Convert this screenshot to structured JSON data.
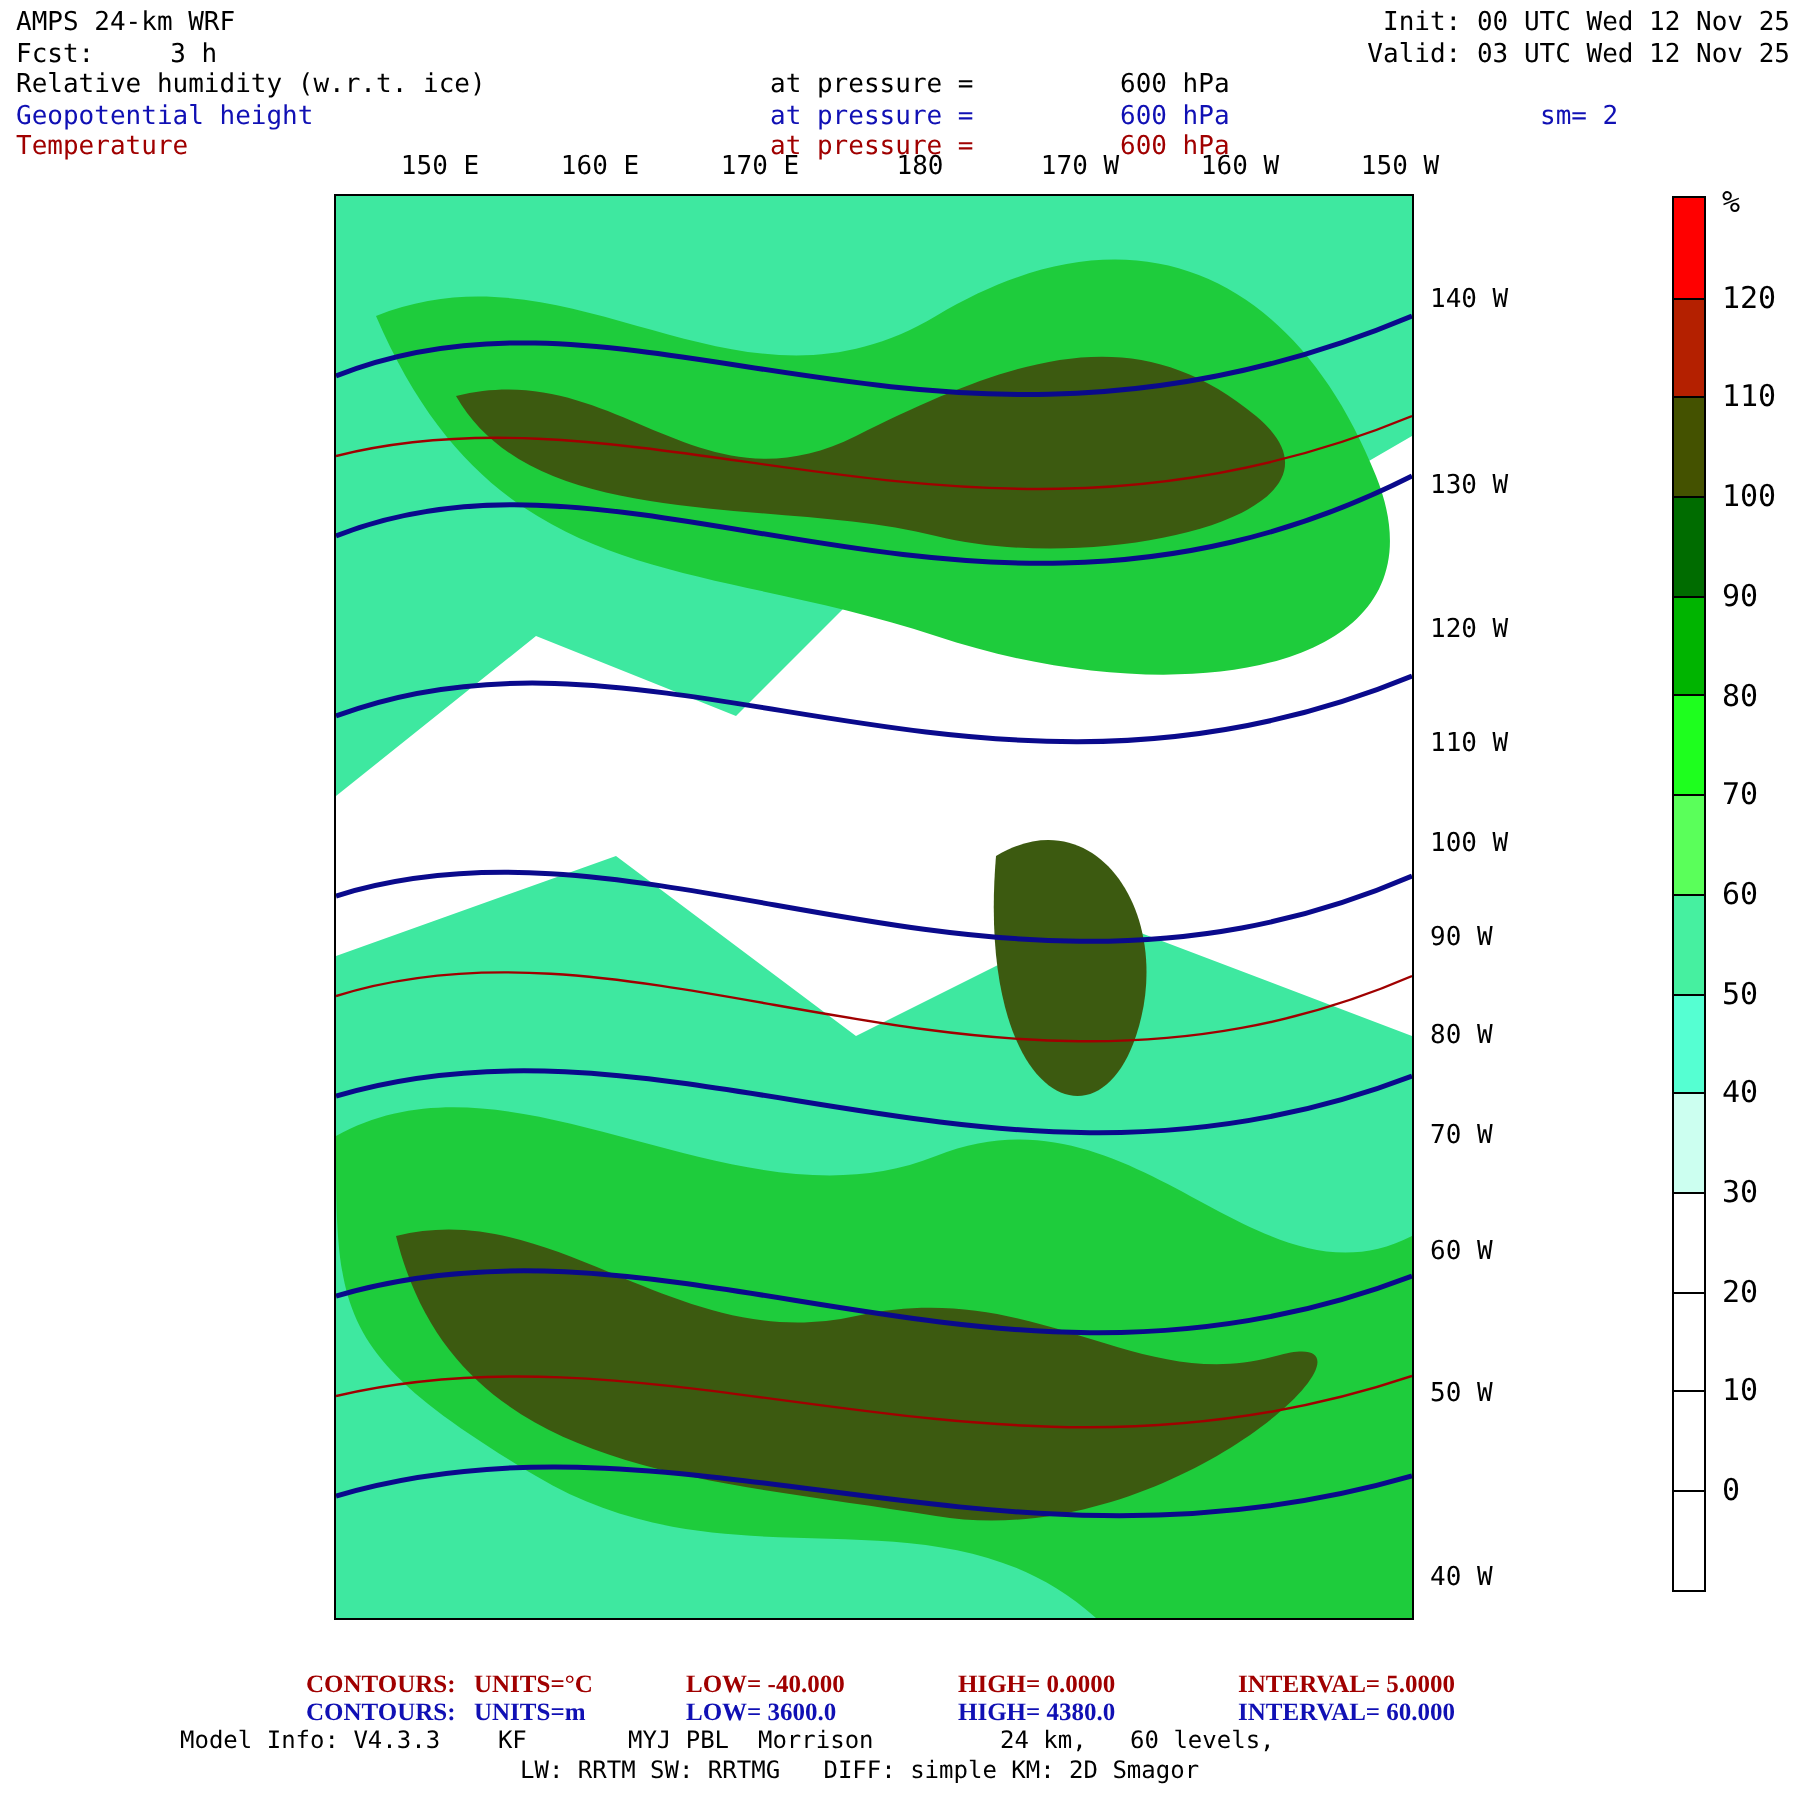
{
  "header": {
    "title": "AMPS 24-km WRF",
    "forecast_label": "Fcst:",
    "forecast": "3 h",
    "init": "Init: 00 UTC Wed 12 Nov 25",
    "valid": "Valid: 03 UTC Wed 12 Nov 25",
    "smoothing": "sm= 2"
  },
  "fields": [
    {
      "name": "Relative humidity (w.r.t. ice)",
      "level_label": "at pressure =",
      "level": "600 hPa",
      "color": "#000000"
    },
    {
      "name": "Geopotential height",
      "level_label": "at pressure =",
      "level": "600 hPa",
      "color": "#1010b4"
    },
    {
      "name": "Temperature",
      "level_label": "at pressure =",
      "level": "600 hPa",
      "color": "#a00000"
    }
  ],
  "map": {
    "top_labels": [
      "150 E",
      "160 E",
      "170 E",
      "180",
      "170 W",
      "160 W",
      "150 W"
    ],
    "right_labels": [
      "140 W",
      "130 W",
      "120 W",
      "110 W",
      "100 W",
      "90 W",
      "80 W",
      "70 W",
      "60 W",
      "50 W",
      "40 W"
    ]
  },
  "colorbar": {
    "unit": "%",
    "bins": [
      {
        "color": "#ff0000",
        "label": "120"
      },
      {
        "color": "#b42000",
        "label": "110"
      },
      {
        "color": "#445200",
        "label": "100"
      },
      {
        "color": "#006c00",
        "label": "90"
      },
      {
        "color": "#00b400",
        "label": "80"
      },
      {
        "color": "#1eff1e",
        "label": "70"
      },
      {
        "color": "#5aff5a",
        "label": "60"
      },
      {
        "color": "#46f0a0",
        "label": "50"
      },
      {
        "color": "#55ffd2",
        "label": "40"
      },
      {
        "color": "#ccfff0",
        "label": "30"
      },
      {
        "color": "#ffffff",
        "label": "20"
      },
      {
        "color": "#ffffff",
        "label": "10"
      },
      {
        "color": "#ffffff",
        "label": "0"
      },
      {
        "color": "#ffffff"
      }
    ]
  },
  "contour_legends": [
    {
      "color": "#a00000",
      "label": "CONTOURS:",
      "units": "UNITS=°C",
      "low": "LOW=  -40.000",
      "high": "HIGH=  0.0000",
      "interval": "INTERVAL=  5.0000"
    },
    {
      "color": "#1010b4",
      "label": "CONTOURS:",
      "units": "UNITS=m",
      "low": "LOW=  3600.0",
      "high": "HIGH=  4380.0",
      "interval": "INTERVAL=  60.000"
    }
  ],
  "model_info": [
    "Model Info: V4.3.3    KF       MYJ PBL  Morrison",
    "24 km,   60 levels,",
    "LW: RRTM SW: RRTMG   DIFF: simple KM: 2D Smagor"
  ]
}
